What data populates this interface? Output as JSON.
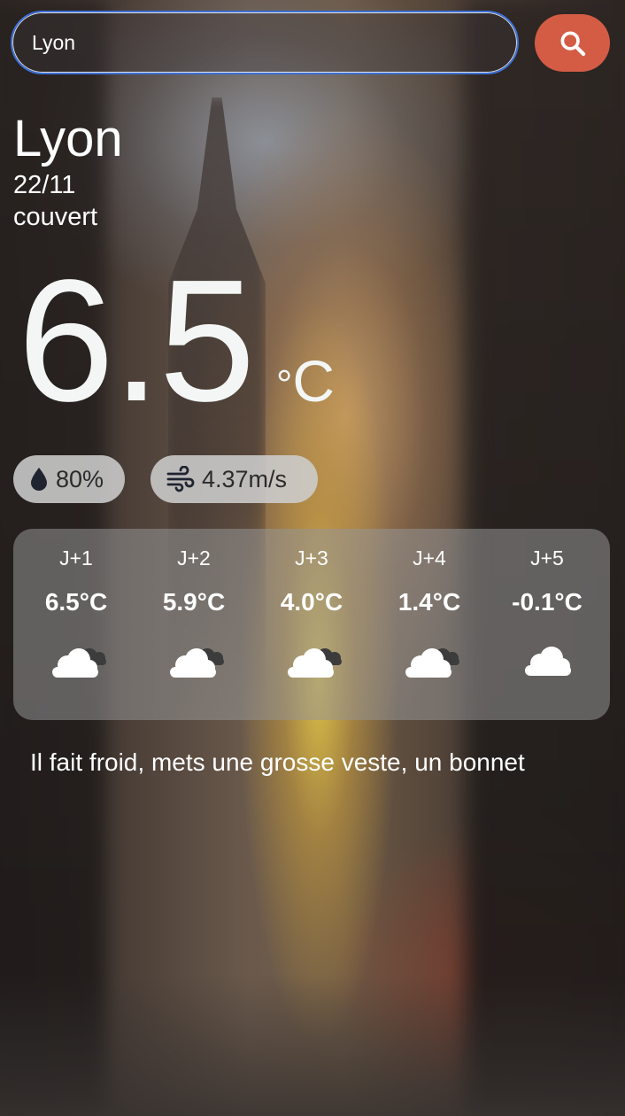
{
  "search": {
    "value": "Lyon",
    "button_icon": "search-icon"
  },
  "weather": {
    "city": "Lyon",
    "date": "22/11",
    "condition": "couvert",
    "temperature": "6.5",
    "unit": "°C",
    "humidity": "80%",
    "wind": "4.37m/s"
  },
  "forecast": [
    {
      "label": "J+1",
      "temp": "6.5°C",
      "icon": "cloudy-icon"
    },
    {
      "label": "J+2",
      "temp": "5.9°C",
      "icon": "cloudy-icon"
    },
    {
      "label": "J+3",
      "temp": "4.0°C",
      "icon": "cloudy-icon"
    },
    {
      "label": "J+4",
      "temp": "1.4°C",
      "icon": "cloudy-icon"
    },
    {
      "label": "J+5",
      "temp": "-0.1°C",
      "icon": "cloud-icon"
    }
  ],
  "advice": "Il fait froid, mets une grosse veste, un bonnet",
  "colors": {
    "search_button": "#d45c45",
    "input_border": "#3b6fd6",
    "chip_bg": "#cdcdcd"
  }
}
